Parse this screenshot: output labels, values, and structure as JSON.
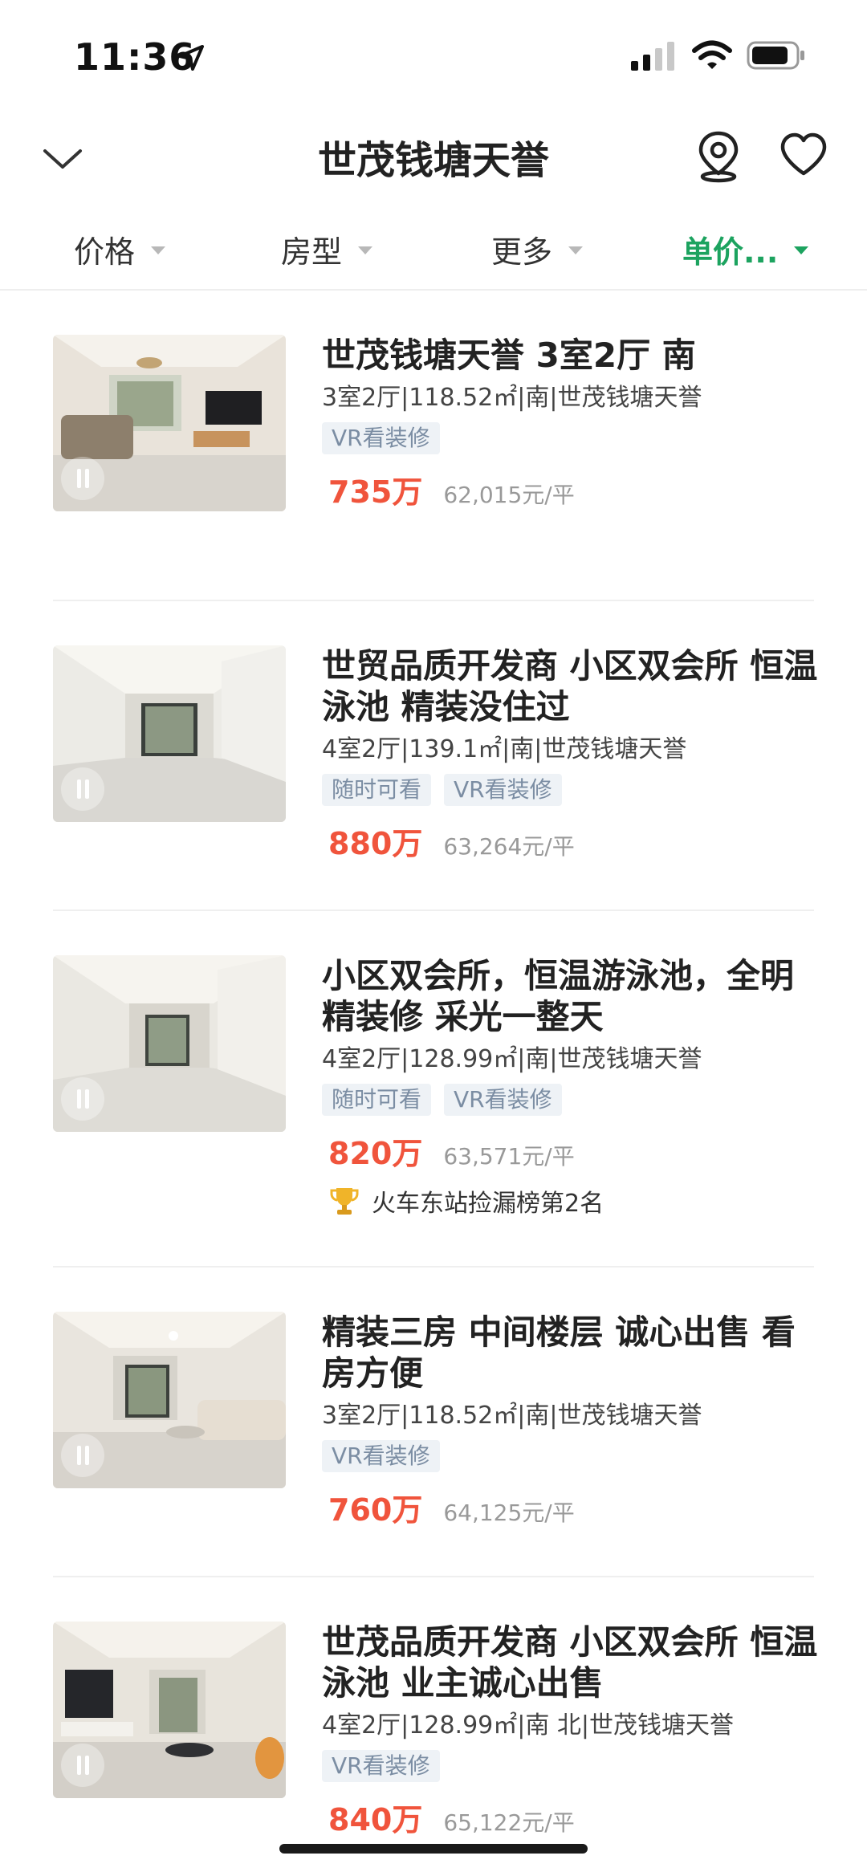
{
  "status_bar": {
    "time": "11:36"
  },
  "header": {
    "title": "世茂钱塘天誉"
  },
  "filters": [
    {
      "label": "价格",
      "active": false
    },
    {
      "label": "房型",
      "active": false
    },
    {
      "label": "更多",
      "active": false
    },
    {
      "label": "单价...",
      "active": true
    }
  ],
  "colors": {
    "accent_green": "#1ca35f",
    "price_red": "#f0543c",
    "tag_text": "#7b8da3",
    "tag_bg": "#eef2f6"
  },
  "listings": [
    {
      "title": "世茂钱塘天誉 3室2厅 南",
      "spec": "3室2厅|118.52㎡|南|世茂钱塘天誉",
      "tags": [
        "VR看装修"
      ],
      "price": "735万",
      "unit_price": "62,015元/平",
      "rank": ""
    },
    {
      "title": "世贸品质开发商 小区双会所 恒温泳池 精装没住过",
      "spec": "4室2厅|139.1㎡|南|世茂钱塘天誉",
      "tags": [
        "随时可看",
        "VR看装修"
      ],
      "price": "880万",
      "unit_price": "63,264元/平",
      "rank": ""
    },
    {
      "title": "小区双会所，恒温游泳池，全明精装修 采光一整天",
      "spec": "4室2厅|128.99㎡|南|世茂钱塘天誉",
      "tags": [
        "随时可看",
        "VR看装修"
      ],
      "price": "820万",
      "unit_price": "63,571元/平",
      "rank": "火车东站捡漏榜第2名"
    },
    {
      "title": "精装三房 中间楼层 诚心出售 看房方便",
      "spec": "3室2厅|118.52㎡|南|世茂钱塘天誉",
      "tags": [
        "VR看装修"
      ],
      "price": "760万",
      "unit_price": "64,125元/平",
      "rank": ""
    },
    {
      "title": "世茂品质开发商 小区双会所 恒温泳池 业主诚心出售",
      "spec": "4室2厅|128.99㎡|南 北|世茂钱塘天誉",
      "tags": [
        "VR看装修"
      ],
      "price": "840万",
      "unit_price": "65,122元/平",
      "rank": ""
    }
  ]
}
